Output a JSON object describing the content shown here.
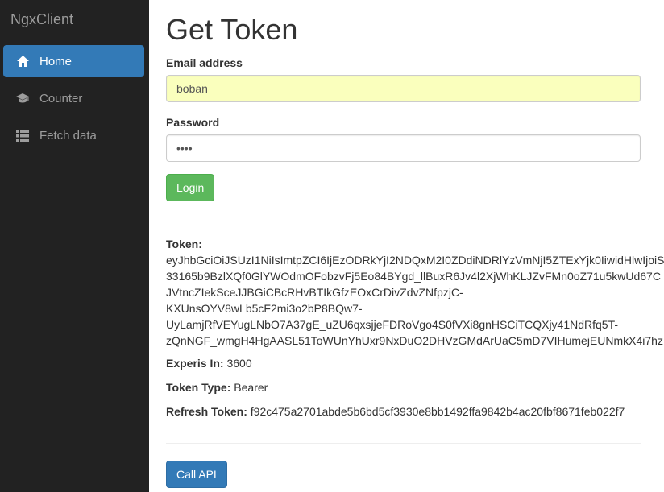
{
  "sidebar": {
    "brand": "NgxClient",
    "items": [
      {
        "label": "Home",
        "icon": "home-icon"
      },
      {
        "label": "Counter",
        "icon": "graduation-cap-icon"
      },
      {
        "label": "Fetch data",
        "icon": "th-list-icon"
      }
    ]
  },
  "main": {
    "title": "Get Token",
    "email": {
      "label": "Email address",
      "value": "boban"
    },
    "password": {
      "label": "Password",
      "value": "••••"
    },
    "login_label": "Login",
    "token": {
      "label": "Token:",
      "lines": [
        "eyJhbGciOiJSUzI1NiIsImtpZCI6IjEzODRkYjI2NDQxM2I0ZDdiNDRlYzVmNjI5ZTExYjk0IiwidHlwIjoiS",
        "33165b9BzlXQf0GlYWOdmOFobzvFj5Eo84BYgd_llBuxR6Jv4l2XjWhKLJZvFMn0oZ71u5kwUd67C",
        "JVtncZIekSceJJBGiCBcRHvBTIkGfzEOxCrDivZdvZNfpzjC-",
        "KXUnsOYV8wLb5cF2mi3o2bP8BQw7-",
        "UyLamjRfVEYugLNbO7A37gE_uZU6qxsjjeFDRoVgo4S0fVXi8gnHSCiTCQXjy41NdRfq5T-",
        "zQnNGF_wmgH4HgAASL51ToWUnYhUxr9NxDuO2DHVzGMdArUaC5mD7VIHumejEUNmkX4i7hz"
      ]
    },
    "expires": {
      "label": "Experis In:",
      "value": "3600"
    },
    "token_type": {
      "label": "Token Type:",
      "value": "Bearer"
    },
    "refresh_token": {
      "label": "Refresh Token:",
      "value": "f92c475a2701abde5b6bd5cf3930e8bb1492ffa9842b4ac20fbf8671feb022f7"
    },
    "call_api_label": "Call API"
  },
  "colors": {
    "sidebar_bg": "#222222",
    "active_item": "#337ab7",
    "login_button": "#5cb85c",
    "call_api_button": "#337ab7",
    "autofill_bg": "#faffbd"
  }
}
